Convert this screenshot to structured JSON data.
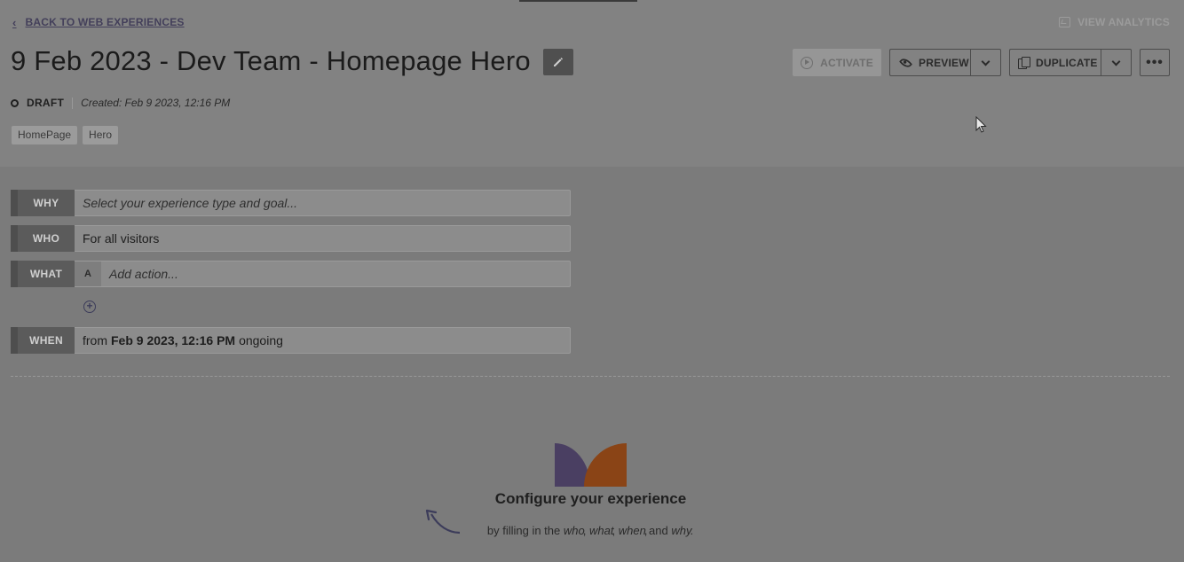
{
  "header": {
    "back_label": "BACK TO WEB EXPERIENCES",
    "view_analytics_label": "VIEW ANALYTICS",
    "title": "9 Feb 2023 - Dev Team - Homepage Hero",
    "status": "DRAFT",
    "created": "Created: Feb 9 2023, 12:16 PM",
    "tags": [
      "HomePage",
      "Hero"
    ]
  },
  "toolbar": {
    "activate_label": "ACTIVATE",
    "preview_label": "PREVIEW",
    "duplicate_label": "DUPLICATE",
    "more_label": "•••"
  },
  "rules": {
    "why": {
      "label": "WHY",
      "value": "Select your experience type and goal..."
    },
    "who": {
      "label": "WHO",
      "value": "For all visitors"
    },
    "what": {
      "label": "WHAT",
      "variant": "A",
      "value": "Add action..."
    },
    "add_symbol": "+",
    "when": {
      "label": "WHEN",
      "prefix": "from",
      "date": "Feb 9 2023, 12:16 PM",
      "suffix": "ongoing"
    }
  },
  "empty_state": {
    "title": "Configure your experience",
    "sub_prefix": "by filling in the",
    "who": "who",
    "what": "what",
    "when": "when",
    "and": "and",
    "why": "why",
    "comma": ",",
    "period": "."
  },
  "colors": {
    "logo_left": "#4a3f62",
    "logo_right": "#8a4416",
    "accent": "#433f5a"
  },
  "icons": [
    "chevron-left-icon",
    "analytics-icon",
    "pencil-icon",
    "play-circle-icon",
    "eye-icon",
    "chevron-down-icon",
    "copy-icon",
    "more-icon",
    "add-circle-icon",
    "arrow-icon",
    "cursor-icon"
  ]
}
